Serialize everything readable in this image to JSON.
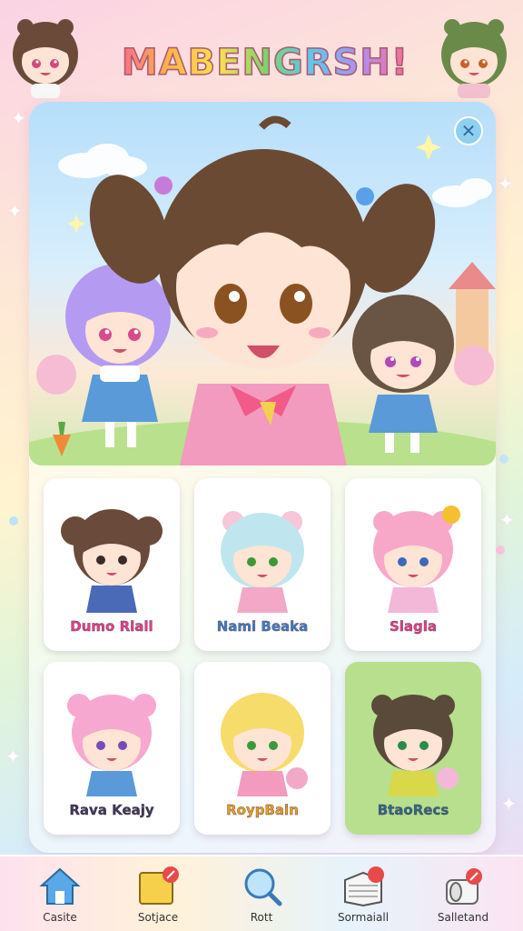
{
  "app": {
    "title": "MABENGRSH!",
    "colors": {
      "accent_pink": "#ff6b8a",
      "selected_card": "#b7df8e",
      "close_button": "#8fd0f2"
    }
  },
  "hero": {
    "close_icon": "close-icon",
    "characters": [
      "main-girl-brown-pigtails",
      "purple-hair-girl",
      "dark-hair-girl"
    ]
  },
  "characters": [
    {
      "name": "Dumo Rlall",
      "label_color": "#e0408a",
      "hair": "#6a4a3a",
      "selected": false
    },
    {
      "name": "Nami Beaka",
      "label_color": "#3d7fc9",
      "hair": "#bfe6ee",
      "selected": false
    },
    {
      "name": "Slagla",
      "label_color": "#e0408a",
      "hair": "#f7a8c8",
      "selected": false
    },
    {
      "name": "Rava Keajy",
      "label_color": "#3a3a5a",
      "hair": "#f7a8d0",
      "selected": false
    },
    {
      "name": "RoypBain",
      "label_color": "#e8a020",
      "hair": "#f6dc6a",
      "selected": false
    },
    {
      "name": "BtaoRecs",
      "label_color": "#2a6a8a",
      "hair": "#5a4a3a",
      "selected": true
    }
  ],
  "nav": [
    {
      "label": "Casite",
      "icon": "home-icon"
    },
    {
      "label": "Sotjace",
      "icon": "sticky-note-icon"
    },
    {
      "label": "Rott",
      "icon": "magnifier-icon"
    },
    {
      "label": "Sormaiall",
      "icon": "book-icon"
    },
    {
      "label": "Salletand",
      "icon": "toilet-paper-icon"
    }
  ]
}
